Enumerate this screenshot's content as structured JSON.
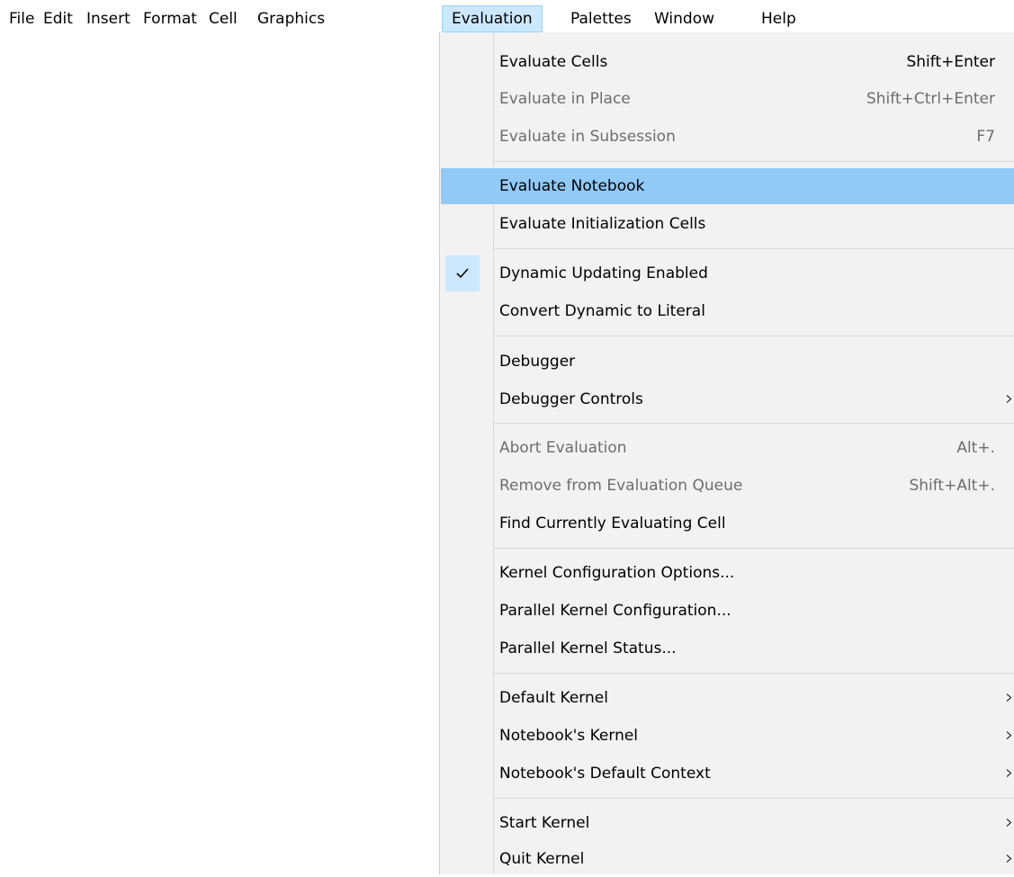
{
  "menubar": {
    "items": [
      "File",
      "Edit",
      "Insert",
      "Format",
      "Cell",
      "Graphics",
      "Evaluation",
      "Palettes",
      "Window",
      "Help"
    ],
    "active": "Evaluation"
  },
  "menu": {
    "items": [
      {
        "label": "Evaluate Cells",
        "shortcut": "Shift+Enter",
        "enabled": true
      },
      {
        "label": "Evaluate in Place",
        "shortcut": "Shift+Ctrl+Enter",
        "enabled": false
      },
      {
        "label": "Evaluate in Subsession",
        "shortcut": "F7",
        "enabled": false
      },
      {
        "label": "Evaluate Notebook",
        "shortcut": "",
        "enabled": true,
        "highlighted": true
      },
      {
        "label": "Evaluate Initialization Cells",
        "shortcut": "",
        "enabled": true
      },
      {
        "label": "Dynamic Updating Enabled",
        "shortcut": "",
        "enabled": true,
        "checked": true
      },
      {
        "label": "Convert Dynamic to Literal",
        "shortcut": "",
        "enabled": true
      },
      {
        "label": "Debugger",
        "shortcut": "",
        "enabled": true
      },
      {
        "label": "Debugger Controls",
        "shortcut": "",
        "enabled": true,
        "submenu": true
      },
      {
        "label": "Abort Evaluation",
        "shortcut": "Alt+.",
        "enabled": false
      },
      {
        "label": "Remove from Evaluation Queue",
        "shortcut": "Shift+Alt+.",
        "enabled": false
      },
      {
        "label": "Find Currently Evaluating Cell",
        "shortcut": "",
        "enabled": true
      },
      {
        "label": "Kernel Configuration Options...",
        "shortcut": "",
        "enabled": true
      },
      {
        "label": "Parallel Kernel Configuration...",
        "shortcut": "",
        "enabled": true
      },
      {
        "label": "Parallel Kernel Status...",
        "shortcut": "",
        "enabled": true
      },
      {
        "label": "Default Kernel",
        "shortcut": "",
        "enabled": true,
        "submenu": true
      },
      {
        "label": "Notebook's Kernel",
        "shortcut": "",
        "enabled": true,
        "submenu": true
      },
      {
        "label": "Notebook's Default Context",
        "shortcut": "",
        "enabled": true,
        "submenu": true
      },
      {
        "label": "Start Kernel",
        "shortcut": "",
        "enabled": true,
        "submenu": true
      },
      {
        "label": "Quit Kernel",
        "shortcut": "",
        "enabled": true,
        "submenu": true
      }
    ]
  },
  "icons": {
    "check": "checkmark-icon",
    "submenu": "chevron-right-icon"
  },
  "colors": {
    "menu_background": "#f2f2f2",
    "highlight": "#91c9f7",
    "active_menubar": "#cce8ff",
    "disabled_text": "#6d6d6d"
  }
}
